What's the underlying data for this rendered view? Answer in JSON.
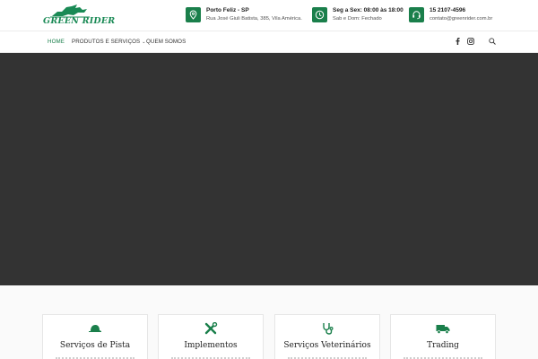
{
  "brand": {
    "logo_text": "GREEN RIDER",
    "accent": "#1a7f4b"
  },
  "header": {
    "location": {
      "icon": "map-pin-icon",
      "title": "Porto Feliz - SP",
      "detail": "Rua José Giuli Batista, 385, Vila América."
    },
    "hours": {
      "icon": "clock-icon",
      "title": "Seg a Sex: 08:00 às 18:00",
      "detail": "Sab e Dom: Fechado"
    },
    "contact": {
      "icon": "headset-icon",
      "title": "15 2107-4596",
      "detail": "contato@greenrider.com.br"
    }
  },
  "nav": {
    "items": [
      {
        "label": "HOME",
        "active": true
      },
      {
        "label": "PRODUTOS E SERVIÇOS",
        "has_dropdown": true
      },
      {
        "label": "QUEM SOMOS"
      }
    ],
    "social": [
      "facebook-icon",
      "instagram-icon"
    ],
    "search_icon": "search-icon"
  },
  "hero": {
    "background": "#333333"
  },
  "services": [
    {
      "title": "Serviços de Pista",
      "icon": "riding-hat-icon"
    },
    {
      "title": "Implementos",
      "icon": "tools-icon"
    },
    {
      "title": "Serviços Veterinários",
      "icon": "stethoscope-icon"
    },
    {
      "title": "Trading",
      "icon": "truck-icon"
    }
  ]
}
